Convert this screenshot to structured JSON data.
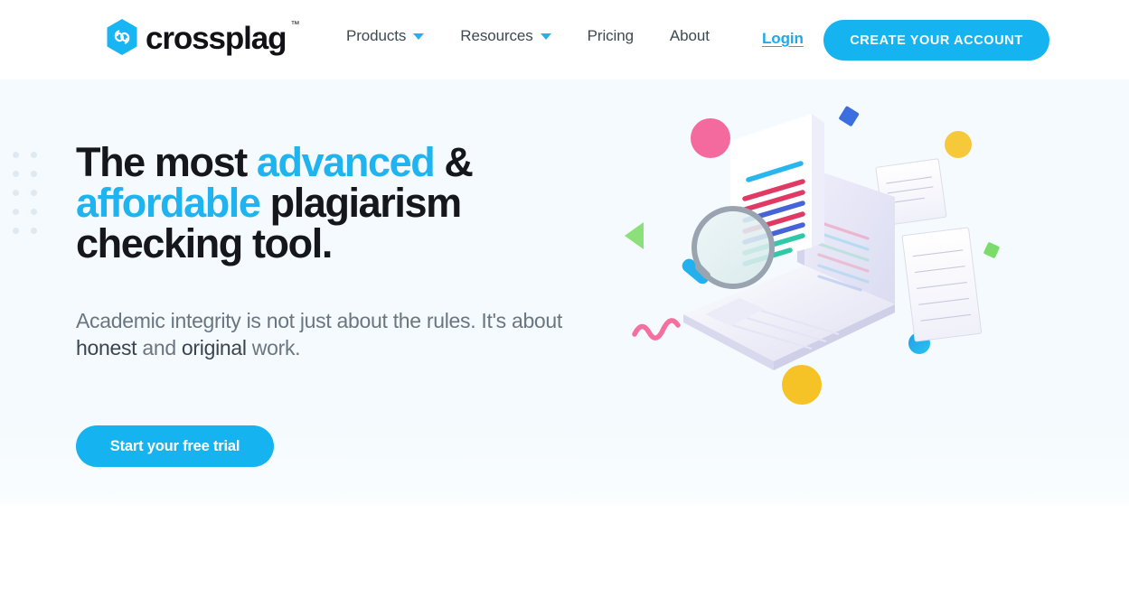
{
  "brand": {
    "name": "crossplag",
    "trademark": "™",
    "logo_icon": "crossplag-hexagon-logo",
    "accent_color": "#15b3f0",
    "text_color": "#111116"
  },
  "header": {
    "nav": [
      {
        "label": "Products",
        "has_dropdown": true,
        "icon": "chevron-down-icon"
      },
      {
        "label": "Resources",
        "has_dropdown": true,
        "icon": "chevron-down-icon"
      },
      {
        "label": "Pricing",
        "has_dropdown": false
      },
      {
        "label": "About",
        "has_dropdown": false
      }
    ],
    "login_label": "Login",
    "create_account_label": "CREATE YOUR ACCOUNT"
  },
  "hero": {
    "title": {
      "part1": "The most ",
      "highlight1": "advanced",
      "part2": " & ",
      "highlight2": "affordable",
      "part3": " plagiarism checking tool."
    },
    "subtitle": {
      "part1": "Academic integrity is not just about the rules. It's about ",
      "bold1": "honest",
      "part2": " and ",
      "bold2": "original",
      "part3": " work."
    },
    "cta_label": "Start your free trial",
    "background_color": "#f4fafd",
    "decorative_dots": {
      "columns": 2,
      "rows": 5,
      "color": "#dee9f2"
    }
  },
  "illustration": {
    "name": "plagiarism-check-laptop-illustration",
    "elements": [
      {
        "name": "pink-circle",
        "color": "#f56a9e"
      },
      {
        "name": "blue-diamond",
        "color": "#3b6fe0"
      },
      {
        "name": "yellow-circle-top",
        "color": "#f5c93a"
      },
      {
        "name": "green-triangle",
        "color": "#8be07a"
      },
      {
        "name": "green-diamond",
        "color": "#7bdb6b"
      },
      {
        "name": "blue-circle",
        "color": "#1e9fe8"
      },
      {
        "name": "yellow-circle-bottom",
        "color": "#f5c326"
      },
      {
        "name": "pink-squiggle",
        "color": "#f5709e"
      },
      {
        "name": "laptop",
        "color": "#e6e6f7"
      },
      {
        "name": "document-sheet",
        "color": "#ffffff"
      },
      {
        "name": "magnifying-glass",
        "color": "#9aa3b0",
        "handle_color": "#22b0ee"
      },
      {
        "name": "floating-paper-top",
        "color": "#fbfbfe"
      },
      {
        "name": "floating-paper-bottom",
        "color": "#fbfbfe"
      }
    ],
    "document_line_colors": [
      "#29b6ef",
      "#e03a64",
      "#4464d8",
      "#2fc9a8"
    ]
  }
}
